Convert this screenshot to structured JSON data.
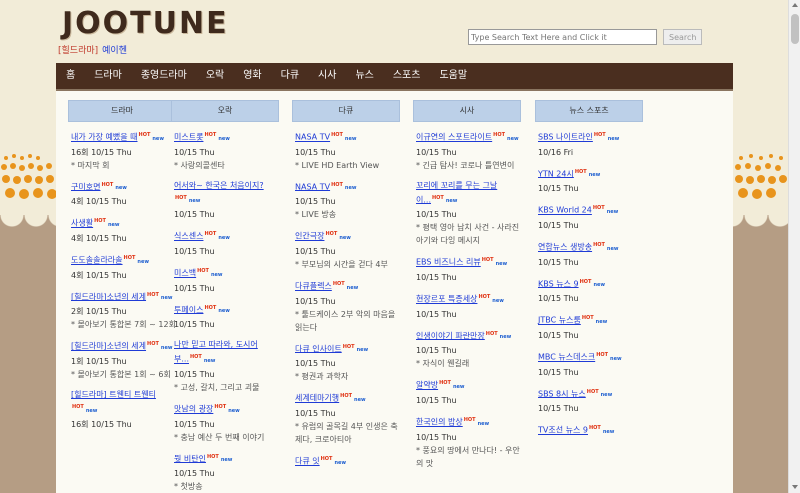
{
  "site": {
    "logo": "JOOTUNE"
  },
  "sublinks": {
    "prefix": "[힐드라마]",
    "link": "예이헨"
  },
  "search": {
    "placeholder": "Type Search Text Here and Click it",
    "button": "Search"
  },
  "nav": [
    "홈",
    "드라마",
    "종영드라마",
    "오락",
    "영화",
    "다큐",
    "시사",
    "뉴스",
    "스포츠",
    "도움말"
  ],
  "badges": {
    "hot": "HOT",
    "new": "new"
  },
  "columns": [
    {
      "header": "드라마",
      "items": [
        {
          "title": "내가 가장 예뻤을 때",
          "date": "16회 10/15 Thu",
          "desc": "* 마지막 회"
        },
        {
          "title": "구미호면",
          "date": "4회 10/15 Thu",
          "desc": ""
        },
        {
          "title": "사생활",
          "date": "4회 10/15 Thu",
          "desc": ""
        },
        {
          "title": "도도솔솔라라솔",
          "date": "4회 10/15 Thu",
          "desc": ""
        },
        {
          "title": "[힐드라마]소년의 세계",
          "date": "2회 10/15 Thu",
          "desc": "* 몰아보기 통합본 7회 ~ 12회"
        },
        {
          "title": "[힐드라마]소년의 세계",
          "date": "1회 10/15 Thu",
          "desc": "* 몰아보기 통합본 1회 ~ 6회"
        },
        {
          "title": "[힐드라마] 트웬티 트웬티",
          "date": "16회 10/15 Thu",
          "desc": ""
        }
      ]
    },
    {
      "header": "오락",
      "items": [
        {
          "title": "미스트롯",
          "date": "10/15 Thu",
          "desc": "* 사랑의콜센타"
        },
        {
          "title": "어서와~ 한국은 처음이지?",
          "date": "10/15 Thu",
          "desc": ""
        },
        {
          "title": "식스센스",
          "date": "10/15 Thu",
          "desc": ""
        },
        {
          "title": "미스백",
          "date": "10/15 Thu",
          "desc": ""
        },
        {
          "title": "투페이스",
          "date": "10/15 Thu",
          "desc": ""
        },
        {
          "title": "나만 믿고 따라와, 도시어부...",
          "date": "10/15 Thu",
          "desc": "* 고성, 갈치, 그리고 괴물"
        },
        {
          "title": "맛남의 광장",
          "date": "10/15 Thu",
          "desc": "* 충남 예산 두 번째 이야기"
        },
        {
          "title": "뭣 비탄인",
          "date": "10/15 Thu",
          "desc": "* 첫방송"
        }
      ]
    },
    {
      "header": "다큐",
      "items": [
        {
          "title": "NASA TV",
          "date": "10/15 Thu",
          "desc": "* LIVE HD Earth View"
        },
        {
          "title": "NASA TV",
          "date": "10/15 Thu",
          "desc": "* LIVE 방송"
        },
        {
          "title": "인간극장",
          "date": "10/15 Thu",
          "desc": "* 부모님의 시간을 걷다 4부"
        },
        {
          "title": "다큐플렉스",
          "date": "10/15 Thu",
          "desc": "* 툴드케이스 2부 악의 마음을 읽는다"
        },
        {
          "title": "다큐 인사이트",
          "date": "10/15 Thu",
          "desc": "* 평권과 과학자"
        },
        {
          "title": "세계테마기행",
          "date": "10/15 Thu",
          "desc": "* 유럽의 골목길 4부 인생은 축제다, 크로아티아"
        },
        {
          "title": "다큐 잇",
          "date": "",
          "desc": ""
        }
      ]
    },
    {
      "header": "시사",
      "items": [
        {
          "title": "이규연의 스포트라이트",
          "date": "10/15 Thu",
          "desc": "* 긴급 탐사! 코로나 틀연변이"
        },
        {
          "title": "꼬리에 꼬리를 무는 그날 이...",
          "date": "10/15 Thu",
          "desc": "* 평택 영아 납치 사건 - 사라진 아기와 다잉 메시지"
        },
        {
          "title": "EBS 비즈니스 리뷰",
          "date": "10/15 Thu",
          "desc": ""
        },
        {
          "title": "현장르포 특종세상",
          "date": "10/15 Thu",
          "desc": ""
        },
        {
          "title": "인생이야기 파란만장",
          "date": "10/15 Thu",
          "desc": "* 자식이 웬길래"
        },
        {
          "title": "알약방",
          "date": "10/15 Thu",
          "desc": ""
        },
        {
          "title": "한국인의 밥상",
          "date": "10/15 Thu",
          "desc": "* 풍요의 땅에서 만나다! - 우안의 맛"
        }
      ]
    },
    {
      "header": "뉴스 스포츠",
      "items": [
        {
          "title": "SBS 나이트라인",
          "date": "10/16 Fri",
          "desc": ""
        },
        {
          "title": "YTN 24시",
          "date": "10/15 Thu",
          "desc": ""
        },
        {
          "title": "KBS World 24",
          "date": "10/15 Thu",
          "desc": ""
        },
        {
          "title": "연합뉴스 생방송",
          "date": "10/15 Thu",
          "desc": ""
        },
        {
          "title": "KBS 뉴스 9",
          "date": "10/15 Thu",
          "desc": ""
        },
        {
          "title": "JTBC 뉴스룸",
          "date": "10/15 Thu",
          "desc": ""
        },
        {
          "title": "MBC 뉴스데스크",
          "date": "10/15 Thu",
          "desc": ""
        },
        {
          "title": "SBS 8시 뉴스",
          "date": "10/15 Thu",
          "desc": ""
        },
        {
          "title": "TV조선 뉴스 9",
          "date": "",
          "desc": ""
        }
      ]
    }
  ]
}
